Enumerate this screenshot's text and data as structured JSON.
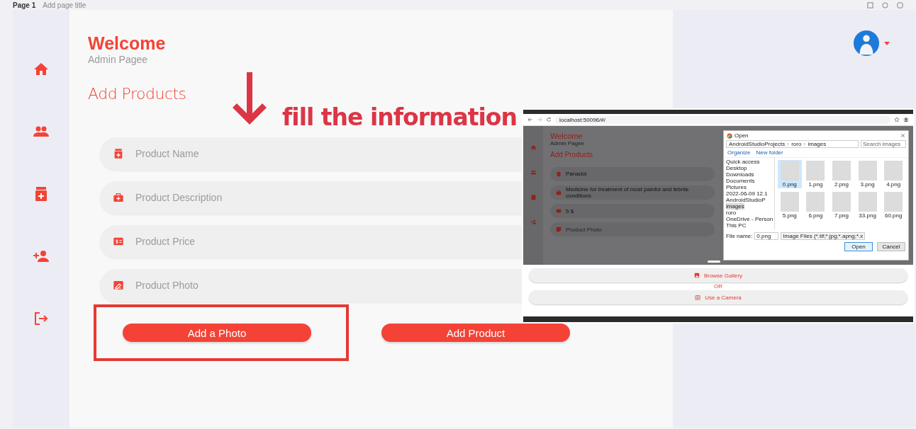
{
  "editor_bar": {
    "page": "Page 1",
    "title_placeholder": "Add page title"
  },
  "sidebar": {
    "items": [
      {
        "kind": "home"
      },
      {
        "kind": "users"
      },
      {
        "kind": "products"
      },
      {
        "kind": "add-user"
      },
      {
        "kind": "logout"
      }
    ]
  },
  "header": {
    "title": "Welcome",
    "subtitle": "Admin Pagee"
  },
  "section_title": "Add Products",
  "annotation": "fill the information",
  "fields": [
    {
      "kind": "name",
      "placeholder": "Product Name"
    },
    {
      "kind": "description",
      "placeholder": "Product Description"
    },
    {
      "kind": "price",
      "placeholder": "Product Price"
    },
    {
      "kind": "photo",
      "placeholder": "Product Photo"
    }
  ],
  "buttons": [
    {
      "label": "Add a Photo",
      "highlighted": true
    },
    {
      "label": "Add Product",
      "highlighted": false
    }
  ],
  "inset": {
    "url": "localhost:50096/#/",
    "app": {
      "title": "Welcome",
      "subtitle": "Admin Pagee",
      "section_title": "Add Products",
      "fields": [
        {
          "kind": "name",
          "value": "Panadol"
        },
        {
          "kind": "description",
          "value": "Medicine for  treatment of most painful and febrile conditions"
        },
        {
          "kind": "price",
          "value": "5 $"
        },
        {
          "kind": "photo",
          "placeholder": "Product Photo"
        }
      ]
    },
    "dialog": {
      "title": "Open",
      "path": [
        "AndroidStudioProjects",
        "roro",
        "images"
      ],
      "search_placeholder": "Search images",
      "toolbar": [
        "Organize",
        "New folder"
      ],
      "nav": [
        {
          "label": "Quick access",
          "selected": false
        },
        {
          "label": "Desktop",
          "selected": false
        },
        {
          "label": "Downloads",
          "selected": false
        },
        {
          "label": "Documents",
          "selected": false
        },
        {
          "label": "Pictures",
          "selected": false
        },
        {
          "label": "2022-06-09 12.1",
          "selected": false
        },
        {
          "label": "AndroidStudioP",
          "selected": false
        },
        {
          "label": "images",
          "selected": true
        },
        {
          "label": "roro",
          "selected": false
        },
        {
          "label": "OneDrive - Person",
          "selected": false
        },
        {
          "label": "This PC",
          "selected": false
        }
      ],
      "files": [
        {
          "name": "0.png",
          "selected": true
        },
        {
          "name": "1.png",
          "selected": false
        },
        {
          "name": "2.png",
          "selected": false
        },
        {
          "name": "3.png",
          "selected": false
        },
        {
          "name": "4.png",
          "selected": false
        },
        {
          "name": "5.png",
          "selected": false
        },
        {
          "name": "6.png",
          "selected": false
        },
        {
          "name": "7.png",
          "selected": false
        },
        {
          "name": "33.png",
          "selected": false
        },
        {
          "name": "60.png",
          "selected": false
        }
      ],
      "file_name_label": "File name:",
      "file_name": "0.png",
      "file_type": "Image Files (*.tif;*.jpg;*.apng;*.x",
      "actions": [
        "Open",
        "Cancel"
      ]
    },
    "sheet": {
      "options": [
        {
          "kind": "gallery",
          "label": "Browse Gallery"
        },
        {
          "kind": "camera",
          "label": "Use a Camera"
        }
      ],
      "separator": "OR"
    }
  }
}
